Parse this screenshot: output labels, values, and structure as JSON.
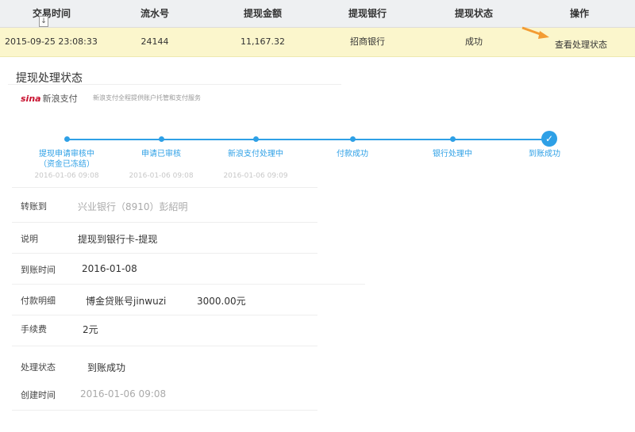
{
  "table": {
    "headers": [
      "交易时间",
      "流水号",
      "提现金额",
      "提现银行",
      "提现状态",
      "操作"
    ],
    "row": {
      "time": "2015-09-25 23:08:33",
      "serial": "24144",
      "amount": "11,167.32",
      "bank": "招商银行",
      "status": "成功",
      "action": "查看处理状态"
    },
    "sort_icon": "sort-down-icon",
    "arrow_color": "#f39c33"
  },
  "panel": {
    "title": "提现处理状态",
    "logo_brand": "sina",
    "logo_sub": "新浪支付",
    "tagline": "新浪支付全程提供账户托管和支付服务"
  },
  "steps": [
    {
      "label": "提现申请审核中",
      "label2": "（资金已冻结）",
      "time": "2016-01-06 09:08"
    },
    {
      "label": "申请已审核",
      "time": "2016-01-06 09:08"
    },
    {
      "label": "新浪支付处理中",
      "time": "2016-01-06 09:09"
    },
    {
      "label": "付款成功",
      "time": ""
    },
    {
      "label": "银行处理中",
      "time": ""
    },
    {
      "label": "到账成功",
      "time": ""
    }
  ],
  "progress_color": "#2ea0e6",
  "details": {
    "transfer_label": "转账到",
    "transfer_value": "兴业银行（8910）彭紹明",
    "note_label": "说明",
    "note_value": "提现到银行卡-提现",
    "arrival_label": "到账时间",
    "arrival_value": "2016-01-08",
    "payment_label": "付款明细",
    "payment_account": "博金贷账号jinwuzi",
    "payment_amount": "3000.00元",
    "fee_label": "手续费",
    "fee_value": "2元",
    "status_label": "处理状态",
    "status_value": "到账成功",
    "created_label": "创建时间",
    "created_value": "2016-01-06 09:08"
  }
}
